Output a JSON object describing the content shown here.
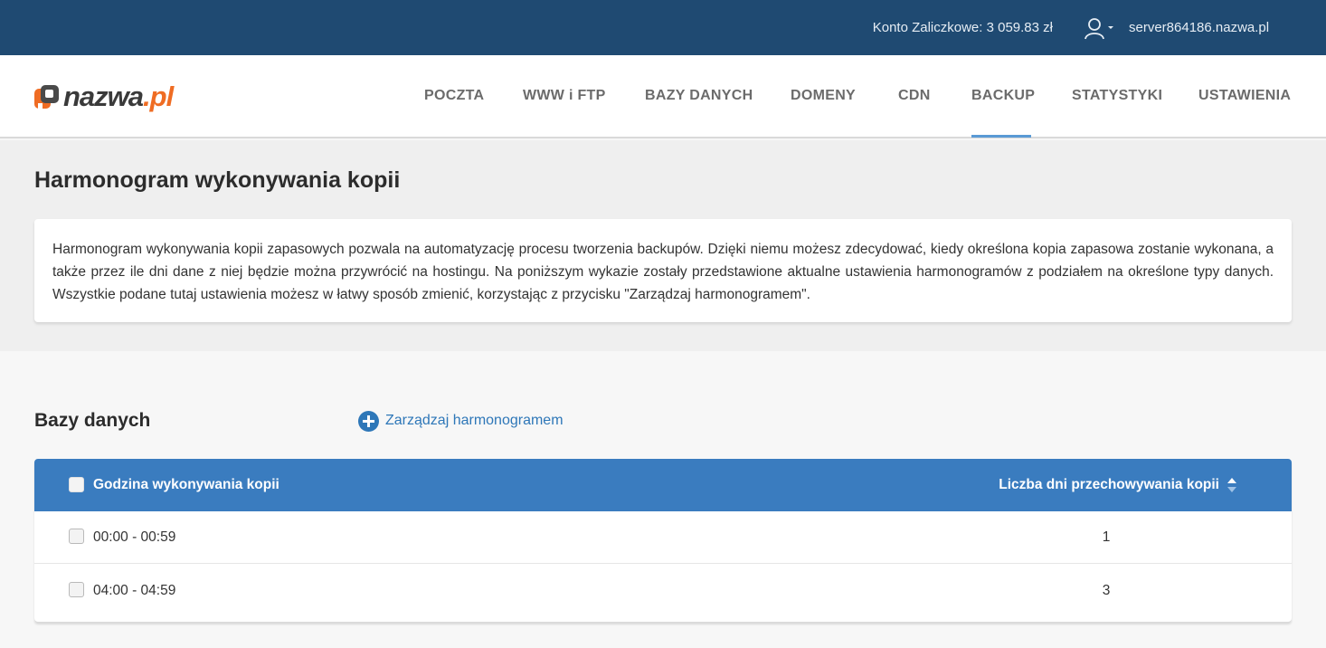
{
  "topbar": {
    "account": "Konto Zaliczkowe: 3 059.83 zł",
    "server": "server864186.nazwa.pl"
  },
  "logo": {
    "name": "nazwa",
    "tld": ".pl"
  },
  "nav": [
    {
      "label": "POCZTA"
    },
    {
      "label": "WWW i FTP"
    },
    {
      "label": "BAZY DANYCH"
    },
    {
      "label": "DOMENY"
    },
    {
      "label": "CDN"
    },
    {
      "label": "BACKUP",
      "active": true
    },
    {
      "label": "STATYSTYKI"
    },
    {
      "label": "USTAWIENIA"
    }
  ],
  "page": {
    "title": "Harmonogram wykonywania kopii",
    "description": "Harmonogram wykonywania kopii zapasowych pozwala na automatyzację procesu tworzenia backupów. Dzięki niemu możesz zdecydować, kiedy określona kopia zapasowa zostanie wykonana, a także przez ile dni dane z niej będzie można przywrócić na hostingu. Na poniższym wykazie zostały przedstawione aktualne ustawienia harmonogramów z podziałem na określone typy danych. Wszystkie podane tutaj ustawienia możesz w łatwy sposób zmienić, korzystając z przycisku \"Zarządzaj harmonogramem\"."
  },
  "section": {
    "title": "Bazy danych",
    "manage_label": "Zarządzaj harmonogramem"
  },
  "table": {
    "columns": [
      "Godzina wykonywania kopii",
      "Liczba dni przechowywania kopii"
    ],
    "rows": [
      {
        "time": "00:00 - 00:59",
        "days": "1"
      },
      {
        "time": "04:00 - 04:59",
        "days": "3"
      }
    ]
  },
  "colors": {
    "topbar": "#1f4a72",
    "accent": "#3a7cbf",
    "brand_orange": "#ef6c23",
    "link": "#2e77b8"
  }
}
